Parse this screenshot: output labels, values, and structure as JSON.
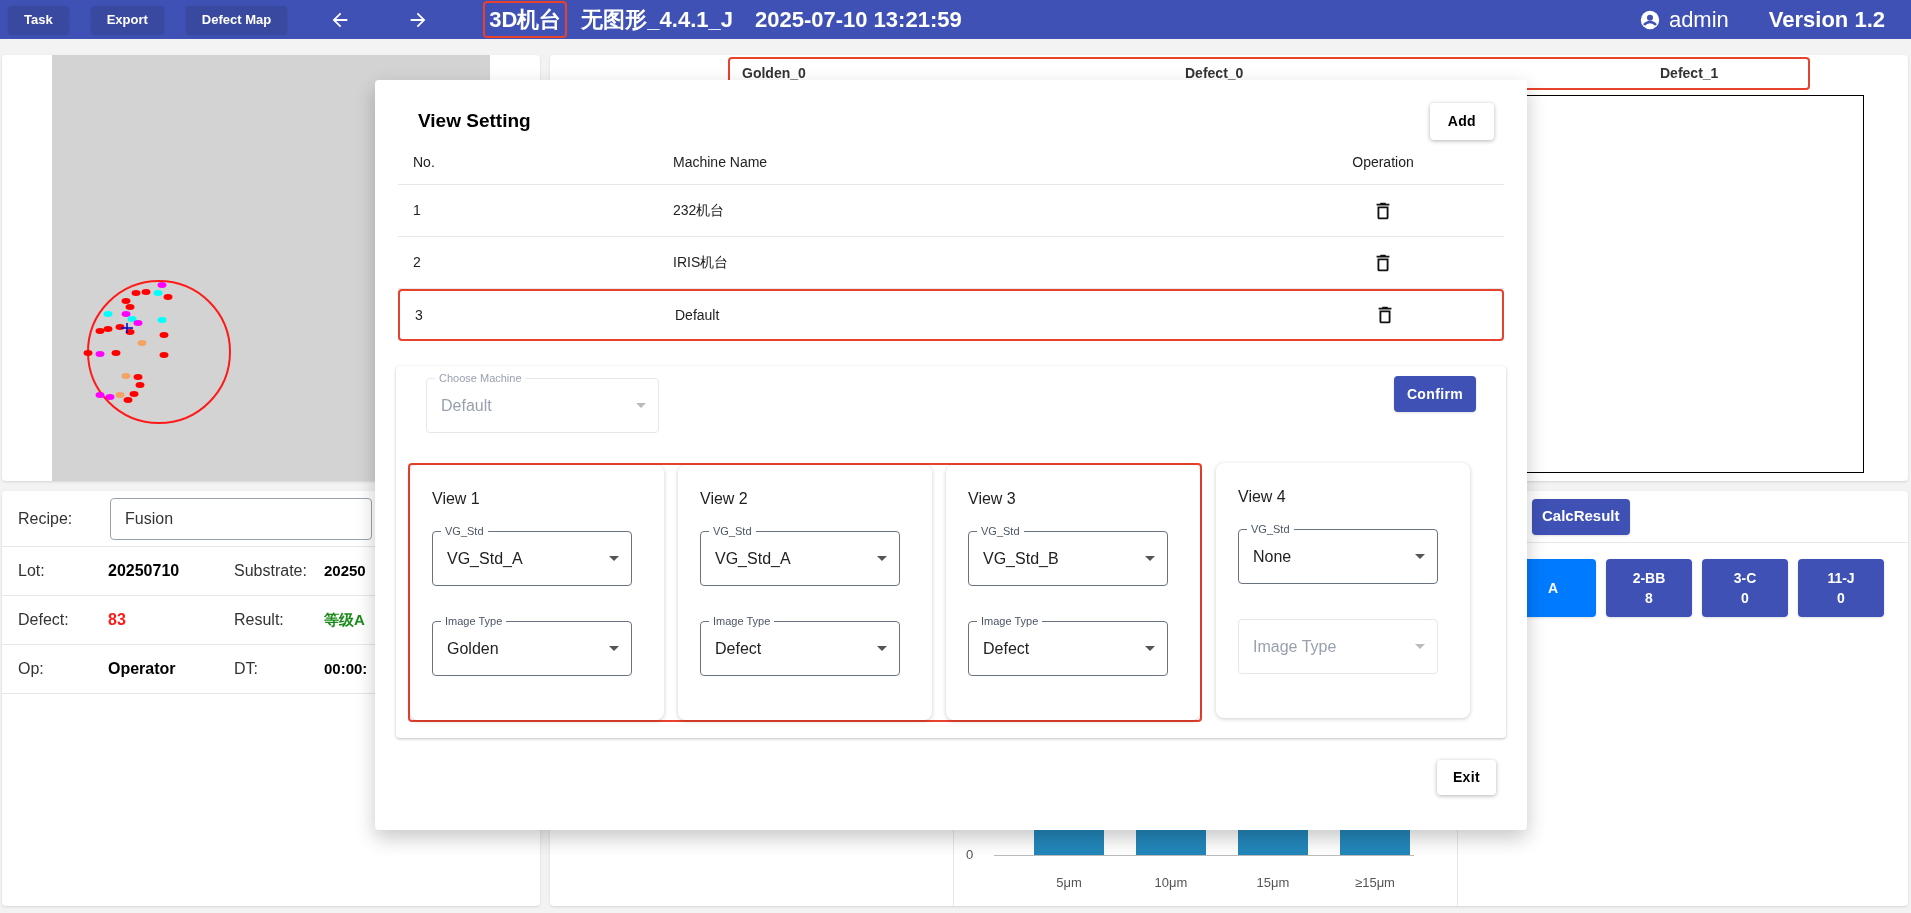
{
  "toolbar": {
    "buttons": [
      "Task",
      "Export",
      "Defect Map"
    ]
  },
  "header": {
    "machine": "3D机台",
    "machine_highlighted": true,
    "recipe_version": "无图形_4.4.1_J",
    "datetime": "2025-07-10 13:21:59",
    "user": "admin",
    "version": "Version 1.2"
  },
  "info": {
    "recipe_label": "Recipe:",
    "recipe_value": "Fusion",
    "rows": [
      [
        {
          "label": "Lot:",
          "value": "20250710",
          "color": "#000000"
        },
        {
          "label": "Substrate:",
          "value": "20250",
          "color": "#000000"
        }
      ],
      [
        {
          "label": "Defect:",
          "value": "83",
          "color": "#ff1a1a"
        },
        {
          "label": "Result:",
          "value": "等级A",
          "color": "#1a8a1a"
        }
      ],
      [
        {
          "label": "Op:",
          "value": "Operator",
          "color": "#000000"
        },
        {
          "label": "DT:",
          "value": "00:00:",
          "color": "#000000"
        }
      ]
    ]
  },
  "image_views": {
    "highlighted": true,
    "tabs": [
      "Golden_0",
      "Defect_0",
      "Defect_1"
    ]
  },
  "classify": {
    "calc_button": "CalcResult",
    "bins": [
      {
        "label": "A",
        "selected": true
      },
      {
        "label": "2-BB",
        "count": "8",
        "selected": false
      },
      {
        "label": "3-C",
        "count": "0",
        "selected": false
      },
      {
        "label": "11-J",
        "count": "0",
        "selected": false
      }
    ]
  },
  "size_chart": {
    "ytick": "0",
    "categories": [
      "5μm",
      "10μm",
      "15μm",
      "≥15μm"
    ]
  },
  "dialog": {
    "title": "View Setting",
    "add_button": "Add",
    "columns": [
      "No.",
      "Machine Name",
      "Operation"
    ],
    "rows": [
      {
        "no": "1",
        "name": "232机台",
        "highlighted": false
      },
      {
        "no": "2",
        "name": "IRIS机台",
        "highlighted": false
      },
      {
        "no": "3",
        "name": "Default",
        "highlighted": true
      }
    ],
    "choose_machine": {
      "label": "Choose Machine",
      "value": "Default",
      "disabled": true
    },
    "confirm_button": "Confirm",
    "views": [
      {
        "title": "View 1",
        "highlighted": true,
        "vg_std": {
          "label": "VG_Std",
          "value": "VG_Std_A"
        },
        "image_type": {
          "label": "Image Type",
          "value": "Golden",
          "disabled": false
        }
      },
      {
        "title": "View 2",
        "highlighted": true,
        "vg_std": {
          "label": "VG_Std",
          "value": "VG_Std_A"
        },
        "image_type": {
          "label": "Image Type",
          "value": "Defect",
          "disabled": false
        }
      },
      {
        "title": "View 3",
        "highlighted": true,
        "vg_std": {
          "label": "VG_Std",
          "value": "VG_Std_B"
        },
        "image_type": {
          "label": "Image Type",
          "value": "Defect",
          "disabled": false
        }
      },
      {
        "title": "View 4",
        "highlighted": false,
        "vg_std": {
          "label": "VG_Std",
          "value": "None"
        },
        "image_type": {
          "label": "Image Type",
          "disabled": true
        }
      }
    ],
    "exit_button": "Exit"
  }
}
